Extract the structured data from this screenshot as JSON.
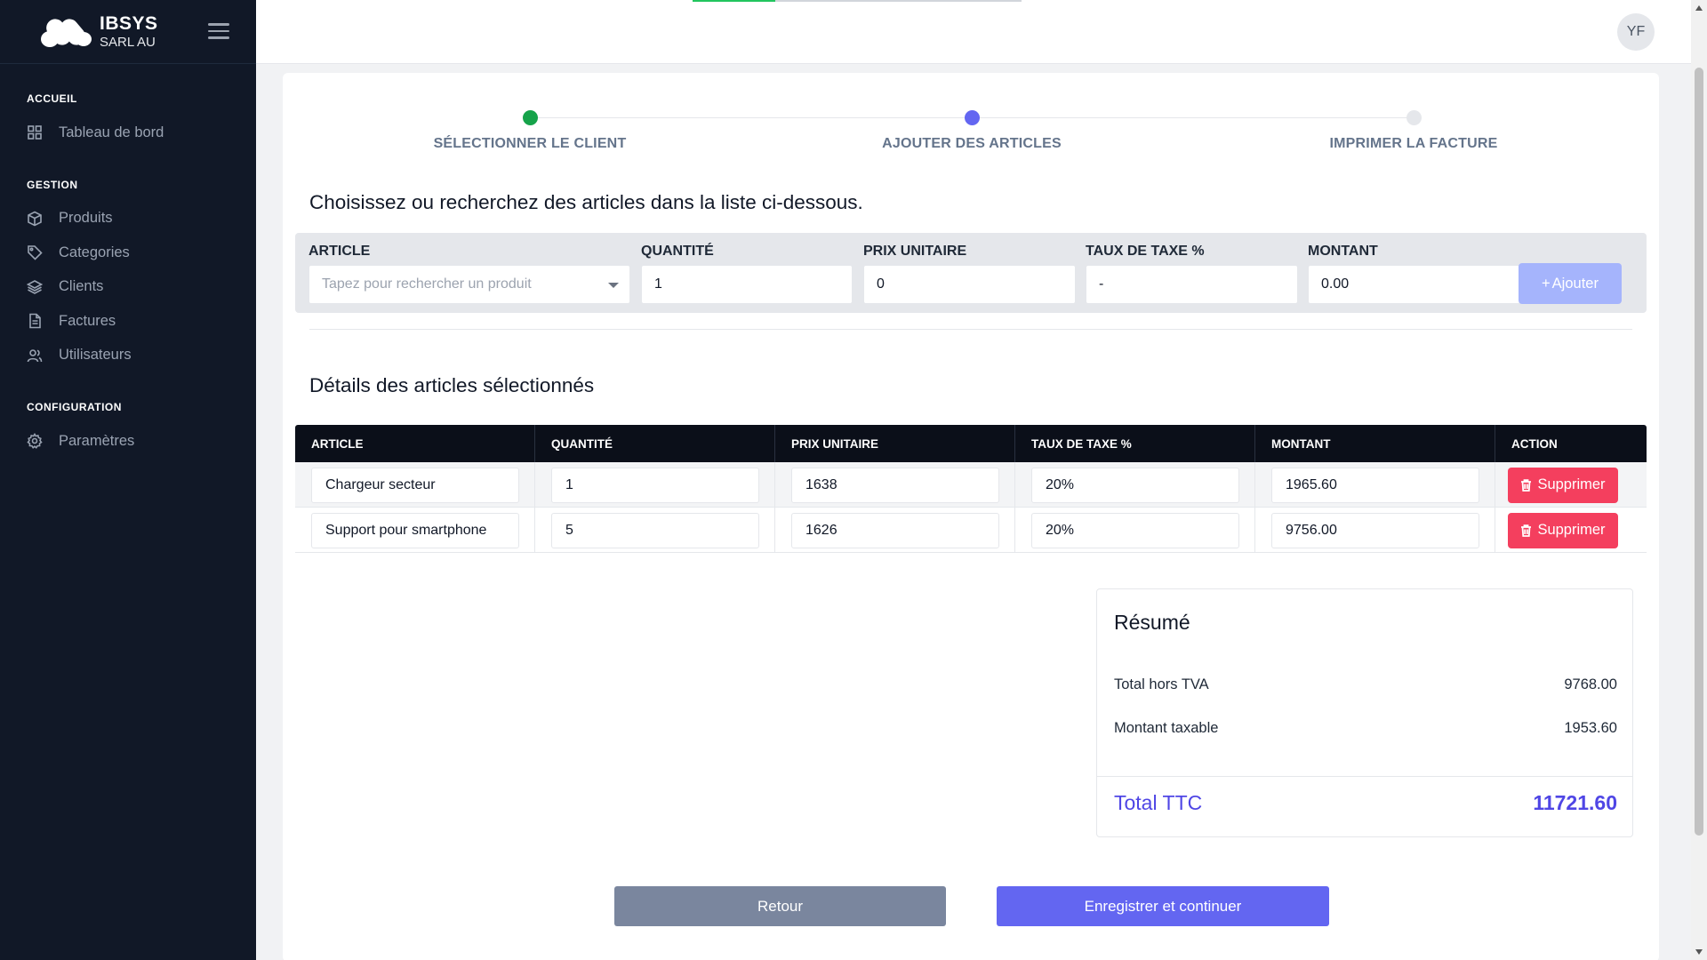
{
  "brand": {
    "name": "IBSYS",
    "subtitle": "SARL AU"
  },
  "sidebar": {
    "sections": [
      {
        "heading": "ACCUEIL",
        "items": [
          {
            "label": "Tableau de bord",
            "icon": "dashboard-icon"
          }
        ]
      },
      {
        "heading": "GESTION",
        "items": [
          {
            "label": "Produits",
            "icon": "box-icon"
          },
          {
            "label": "Categories",
            "icon": "tag-icon"
          },
          {
            "label": "Clients",
            "icon": "layers-icon"
          },
          {
            "label": "Factures",
            "icon": "document-icon"
          },
          {
            "label": "Utilisateurs",
            "icon": "users-icon"
          }
        ]
      },
      {
        "heading": "CONFIGURATION",
        "items": [
          {
            "label": "Paramètres",
            "icon": "gear-icon"
          }
        ]
      }
    ]
  },
  "topbar": {
    "avatar_initials": "YF",
    "progress": 0.25
  },
  "stepper": {
    "steps": [
      {
        "label": "SÉLECTIONNER LE CLIENT",
        "state": "done",
        "color": "#16a34a"
      },
      {
        "label": "AJOUTER DES ARTICLES",
        "state": "current",
        "color": "#6366f1"
      },
      {
        "label": "IMPRIMER LA FACTURE",
        "state": "pending",
        "color": "#e5e7eb"
      }
    ]
  },
  "form": {
    "title": "Choisissez ou recherchez des articles dans la liste ci-dessous.",
    "article_label": "ARTICLE",
    "article_placeholder": "Tapez pour rechercher un produit",
    "quantity_label": "QUANTITÉ",
    "quantity_value": "1",
    "unit_price_label": "PRIX UNITAIRE",
    "unit_price_value": "0",
    "tax_label": "TAUX DE TAXE %",
    "tax_value": "-",
    "amount_label": "MONTANT",
    "amount_value": "0.00",
    "add_button": "Ajouter"
  },
  "details": {
    "title": "Détails des articles sélectionnés",
    "columns": [
      "ARTICLE",
      "QUANTITÉ",
      "PRIX UNITAIRE",
      "TAUX DE TAXE %",
      "MONTANT",
      "ACTION"
    ],
    "rows": [
      {
        "article": "Chargeur secteur",
        "quantity": "1",
        "unit_price": "1638",
        "tax": "20%",
        "amount": "1965.60",
        "action": "Supprimer"
      },
      {
        "article": "Support pour smartphone",
        "quantity": "5",
        "unit_price": "1626",
        "tax": "20%",
        "amount": "9756.00",
        "action": "Supprimer"
      }
    ]
  },
  "summary": {
    "title": "Résumé",
    "subtotal_label": "Total hors TVA",
    "subtotal_value": "9768.00",
    "taxable_label": "Montant taxable",
    "taxable_value": "1953.60",
    "total_label": "Total TTC",
    "total_value": "11721.60"
  },
  "actions": {
    "back": "Retour",
    "save": "Enregistrer et continuer"
  },
  "colors": {
    "sidebar_bg": "#111827",
    "accent": "#6366f1",
    "danger": "#f43f5e",
    "success": "#16a34a"
  }
}
